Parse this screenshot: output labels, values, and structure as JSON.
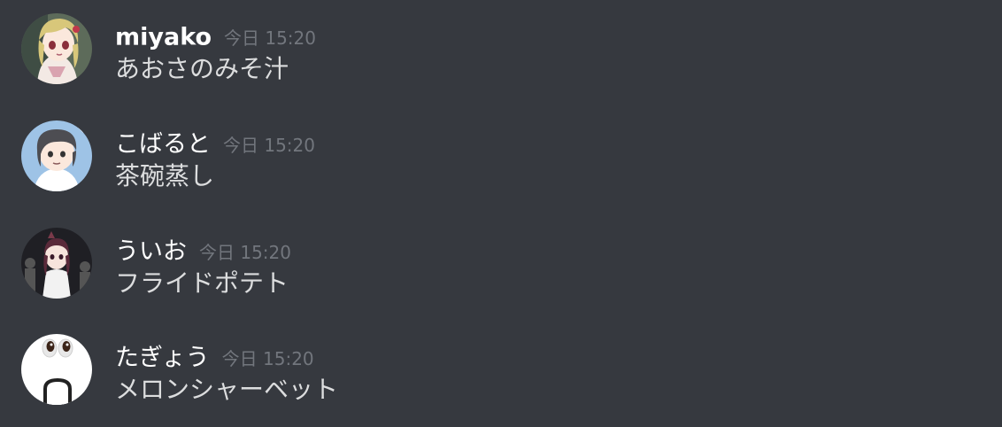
{
  "messages": [
    {
      "username": "miyako",
      "timestamp": "今日 15:20",
      "content": "あおさのみそ汁",
      "avatar_icon": "anime-girl-avatar-icon"
    },
    {
      "username": "こばると",
      "timestamp": "今日 15:20",
      "content": "茶碗蒸し",
      "avatar_icon": "anime-boy-avatar-icon"
    },
    {
      "username": "ういお",
      "timestamp": "今日 15:20",
      "content": "フライドポテト",
      "avatar_icon": "anime-character-avatar-icon"
    },
    {
      "username": "たぎょう",
      "timestamp": "今日 15:20",
      "content": "メロンシャーベット",
      "avatar_icon": "surprised-face-avatar-icon"
    }
  ],
  "colors": {
    "background": "#36393f",
    "username": "#ffffff",
    "timestamp": "#72767d",
    "message_text": "#dcddde"
  }
}
